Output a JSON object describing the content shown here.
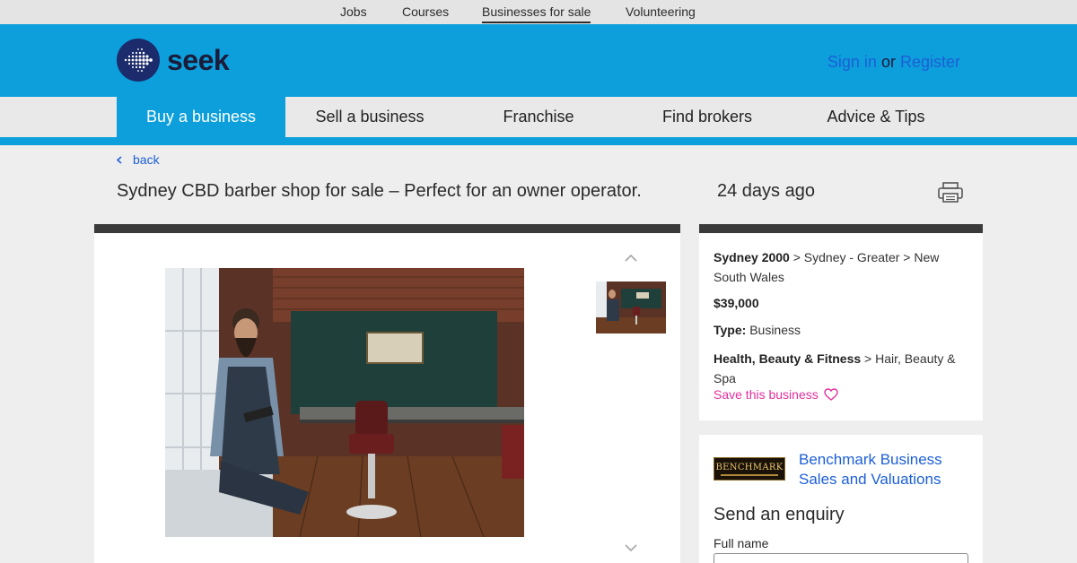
{
  "topnav": {
    "links": [
      "Jobs",
      "Courses",
      "Businesses for sale",
      "Volunteering"
    ]
  },
  "header": {
    "logo_text": "seek",
    "sign_in": "Sign in",
    "or": "or",
    "register": "Register"
  },
  "mainnav": {
    "items": [
      "Buy a business",
      "Sell a business",
      "Franchise",
      "Find brokers",
      "Advice & Tips"
    ]
  },
  "page": {
    "back": "back",
    "title": "Sydney CBD barber shop for sale – Perfect for an owner operator.",
    "posted": "24 days ago"
  },
  "details": {
    "location_bold": "Sydney 2000",
    "location_rest": " > Sydney - Greater > New South Wales",
    "price": "$39,000",
    "type_label": "Type:",
    "type_value": " Business",
    "category_bold": "Health, Beauty & Fitness",
    "category_rest": " > Hair, Beauty & Spa",
    "save": "Save this business"
  },
  "enquiry": {
    "broker_logo_text": "BENCHMARK",
    "broker_name": "Benchmark Business Sales and Valuations",
    "heading": "Send an enquiry",
    "full_name_label": "Full name",
    "full_name_value": ""
  },
  "colors": {
    "brand_blue": "#0d9fdb",
    "link_blue": "#1c5fd6",
    "save_pink": "#e0309d"
  },
  "icons": [
    "seek-logo-icon",
    "chevron-left-icon",
    "printer-icon",
    "chevron-up-icon",
    "chevron-down-icon",
    "heart-icon"
  ]
}
